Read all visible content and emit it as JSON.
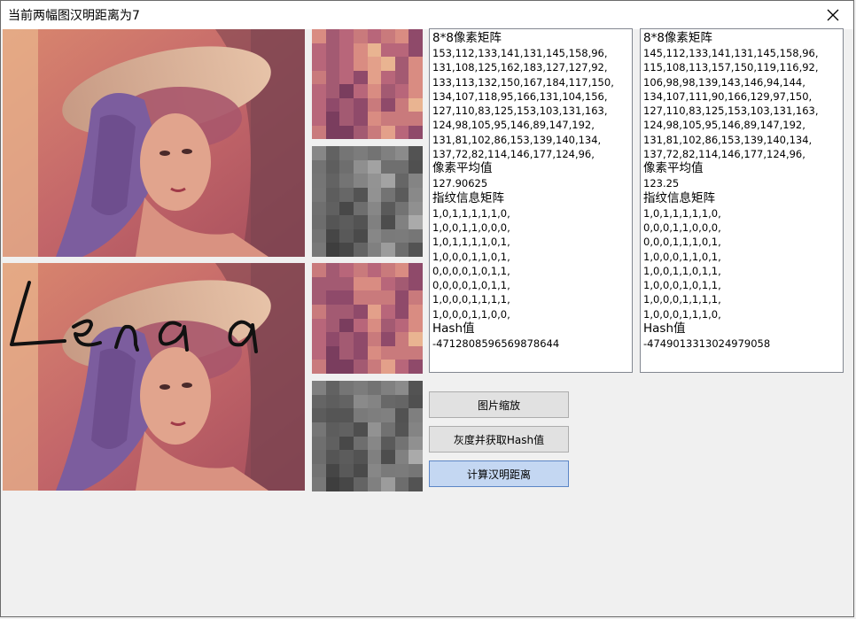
{
  "window": {
    "title": "当前两幅图汉明距离为7"
  },
  "images": {
    "top_caption": "",
    "bottom_handwriting": "Lena"
  },
  "left_panel": {
    "h1": "8*8像素矩阵",
    "matrix": [
      "153,112,133,141,131,145,158,96,",
      "131,108,125,162,183,127,127,92,",
      "133,113,132,150,167,184,117,150,",
      "134,107,118,95,166,131,104,156,",
      "127,110,83,125,153,103,131,163,",
      "124,98,105,95,146,89,147,192,",
      "131,81,102,86,153,139,140,134,",
      "137,72,82,114,146,177,124,96,"
    ],
    "h2": "像素平均值",
    "average": "127.90625",
    "h3": "指纹信息矩阵",
    "fingerprint": [
      "1,0,1,1,1,1,1,0,",
      "1,0,0,1,1,0,0,0,",
      "1,0,1,1,1,1,0,1,",
      "1,0,0,0,1,1,0,1,",
      "0,0,0,0,1,0,1,1,",
      "0,0,0,0,1,0,1,1,",
      "1,0,0,0,1,1,1,1,",
      "1,0,0,0,1,1,0,0,"
    ],
    "h4": "Hash值",
    "hash": "-4712808596569878644"
  },
  "right_panel": {
    "h1": "8*8像素矩阵",
    "matrix": [
      "145,112,133,141,131,145,158,96,",
      "115,108,113,157,150,119,116,92,",
      "106,98,98,139,143,146,94,144,",
      "134,107,111,90,166,129,97,150,",
      "127,110,83,125,153,103,131,163,",
      "124,98,105,95,146,89,147,192,",
      "131,81,102,86,153,139,140,134,",
      "137,72,82,114,146,177,124,96,"
    ],
    "h2": "像素平均值",
    "average": "123.25",
    "h3": "指纹信息矩阵",
    "fingerprint": [
      "1,0,1,1,1,1,1,0,",
      "0,0,0,1,1,0,0,0,",
      "0,0,0,1,1,1,0,1,",
      "1,0,0,0,1,1,0,1,",
      "1,0,0,1,1,0,1,1,",
      "1,0,0,0,1,0,1,1,",
      "1,0,0,0,1,1,1,1,",
      "1,0,0,0,1,1,1,0,"
    ],
    "h4": "Hash值",
    "hash": "-4749013313024979058"
  },
  "buttons": {
    "scale": "图片缩放",
    "gray_hash": "灰度并获取Hash值",
    "hamming": "计算汉明距离"
  },
  "colors": {
    "primary_button": "#c4d7f2",
    "close_icon": "#000000"
  }
}
